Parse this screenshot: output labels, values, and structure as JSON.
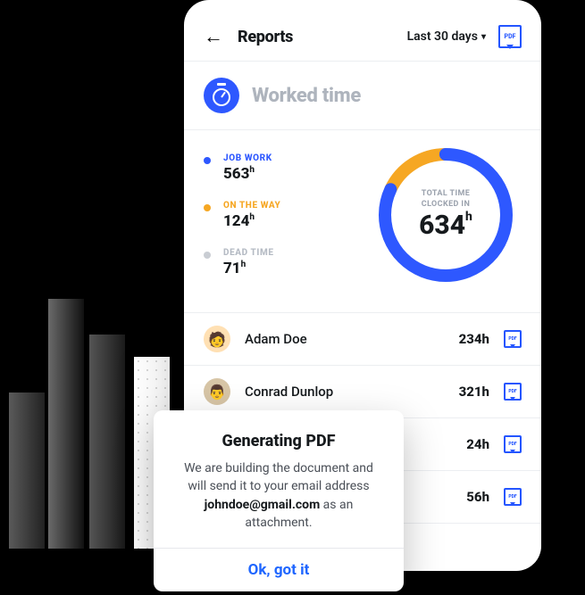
{
  "header": {
    "title": "Reports",
    "range_label": "Last 30 days"
  },
  "section": {
    "title": "Worked time"
  },
  "legend": {
    "job_work": {
      "label": "JOB WORK",
      "value": "563",
      "unit": "h"
    },
    "on_the_way": {
      "label": "ON THE WAY",
      "value": "124",
      "unit": "h"
    },
    "dead_time": {
      "label": "DEAD TIME",
      "value": "71",
      "unit": "h"
    }
  },
  "donut": {
    "label_line1": "TOTAL TIME",
    "label_line2": "CLOCKED IN",
    "value": "634",
    "unit": "h"
  },
  "chart_data": {
    "type": "pie",
    "title": "Worked time",
    "series": [
      {
        "name": "JOB WORK",
        "value": 563,
        "color": "#2e58ff"
      },
      {
        "name": "ON THE WAY",
        "value": 124,
        "color": "#f6a723"
      }
    ],
    "annotations": [
      {
        "name": "DEAD TIME",
        "value": 71
      }
    ],
    "center_label": "TOTAL TIME CLOCKED IN",
    "center_value": 634,
    "unit": "h"
  },
  "employees": [
    {
      "name": "Adam Doe",
      "hours": "234h"
    },
    {
      "name": "Conrad Dunlop",
      "hours": "321h"
    },
    {
      "name": "",
      "hours": "24h"
    },
    {
      "name": "",
      "hours": "56h"
    }
  ],
  "dialog": {
    "title": "Generating PDF",
    "message_pre": "We are building the document and will send it to your email address ",
    "email": "johndoe@gmail.com",
    "message_post": " as an attachment.",
    "button": "Ok, got it"
  },
  "colors": {
    "primary": "#2e58ff",
    "accent": "#f6a723"
  }
}
